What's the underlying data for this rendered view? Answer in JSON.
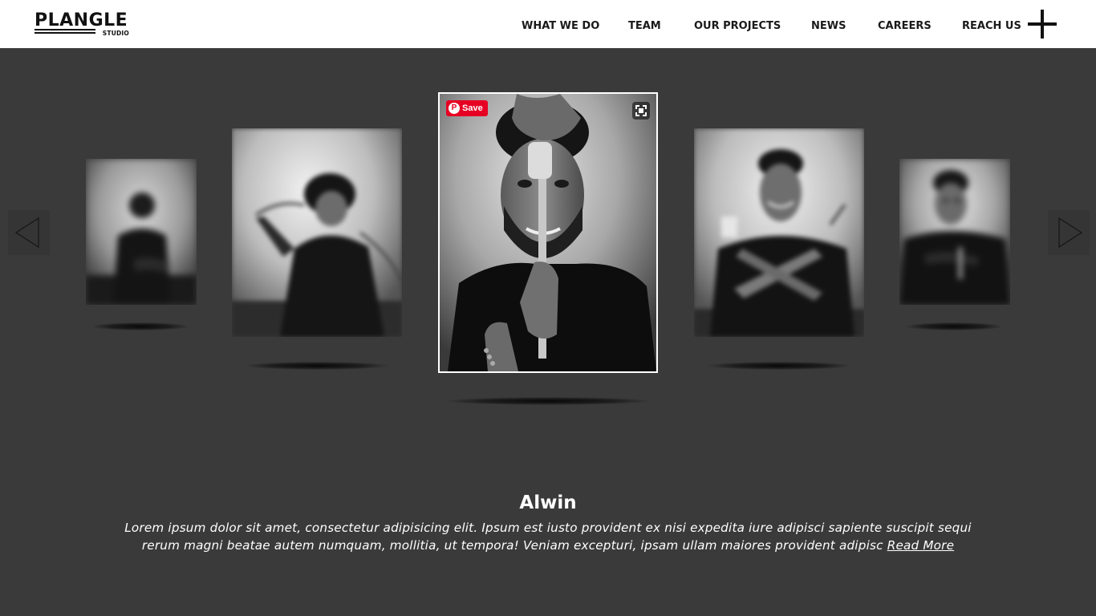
{
  "brand": {
    "logo_main": "PLANGLE",
    "logo_sub": "STUDIO"
  },
  "nav": {
    "items": [
      {
        "label": "WHAT WE DO"
      },
      {
        "label": "TEAM"
      },
      {
        "label": "OUR PROJECTS"
      },
      {
        "label": "NEWS"
      },
      {
        "label": "CAREERS"
      },
      {
        "label": "REACH US"
      }
    ],
    "menu_icon": "plus-icon"
  },
  "carousel": {
    "prev_icon": "triangle-left-icon",
    "next_icon": "triangle-right-icon",
    "save_label": "Save",
    "expand_icon": "expand-icon",
    "active_index": 2
  },
  "profile": {
    "name": "Alwin",
    "bio": "Lorem ipsum dolor sit amet, consectetur adipisicing elit. Ipsum est iusto provident ex nisi expedita iure adipisci sapiente suscipit sequi rerum magni beatae autem numquam, mollitia, ut tempora! Veniam excepturi, ipsam ullam maiores provident adipisc",
    "read_more": "Read More"
  },
  "colors": {
    "page_bg": "#3a3a3a",
    "header_bg": "#ffffff",
    "pinterest": "#e60023"
  }
}
